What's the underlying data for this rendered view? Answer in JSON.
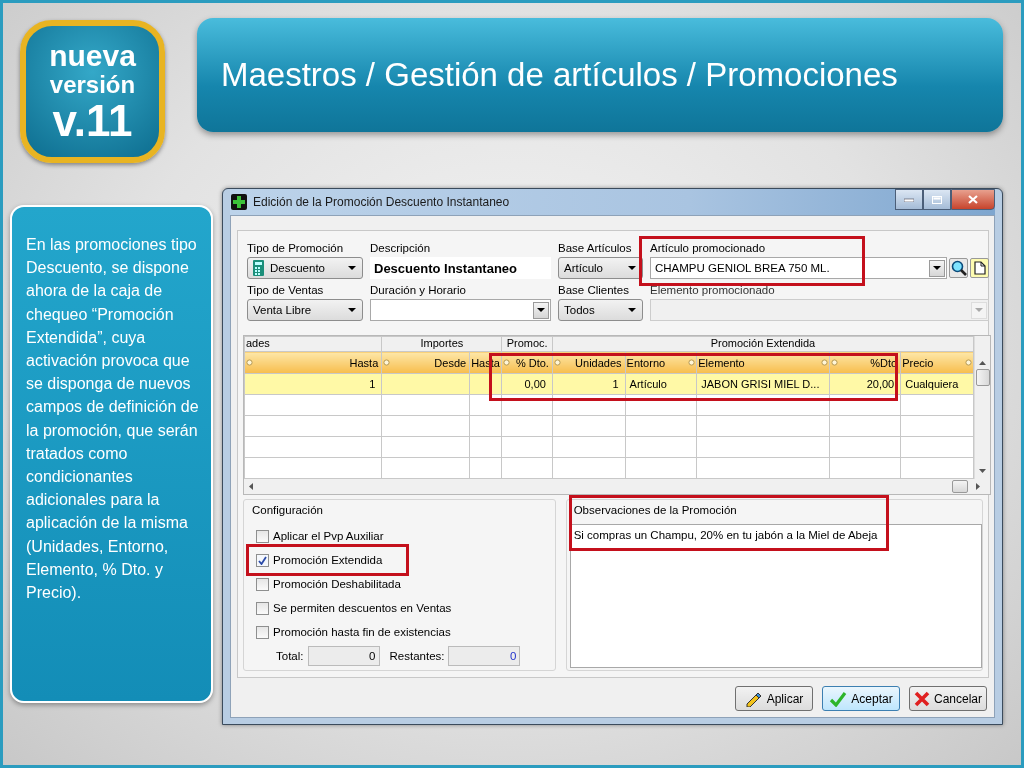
{
  "logo": {
    "lines": [
      "nueva",
      "versión",
      "v.11"
    ]
  },
  "title": "Maestros / Gestión de artículos / Promociones",
  "note": "En las promociones tipo Descuento, se dispone ahora de la caja de chequeo “Promoción Extendida”, cuya activación provoca que se disponga de nuevos campos de definición de la promoción, que serán tratados como condicionantes adicionales para la aplicación de la misma (Unidades, Entorno, Elemento, % Dto. y Precio).",
  "window": {
    "title": "Edición de la Promoción Descuento Instantaneo",
    "fields": [
      {
        "kind": "dropdown",
        "label": "Tipo de Promoción",
        "value": "Descuento",
        "icon": true
      },
      {
        "kind": "text",
        "label": "Descripción",
        "value": "Descuento Instantaneo"
      },
      {
        "kind": "dropdown",
        "label": "Base Artículos",
        "value": "Artículo"
      },
      {
        "kind": "lookup",
        "label": "Artículo promocionado",
        "value": "CHAMPU GENIOL BREA 750 ML.",
        "disabled": false
      },
      {
        "kind": "dropdown",
        "label": "Tipo de Ventas",
        "value": "Venta Libre"
      },
      {
        "kind": "combo",
        "label": "Duración y Horario",
        "disabled": false
      },
      {
        "kind": "dropdown",
        "label": "Base Clientes",
        "value": "Todos"
      },
      {
        "kind": "combo",
        "label": "Elemento promocionado",
        "disabled": true
      }
    ],
    "grid": {
      "groups": [
        {
          "label": "ades",
          "columns": [
            {
              "label": "Hasta",
              "sort_marker": true,
              "kind": "number"
            }
          ]
        },
        {
          "label": "Importes",
          "columns": [
            {
              "label": "Desde",
              "sort_marker": true,
              "kind": "number"
            },
            {
              "label": "Hasta",
              "sort_marker": false,
              "kind": "number"
            }
          ]
        },
        {
          "label": "Promoc.",
          "columns": [
            {
              "label": "% Dto.",
              "sort_marker": true,
              "kind": "number"
            }
          ]
        },
        {
          "label": "Promoción Extendida",
          "columns": [
            {
              "label": "Unidades",
              "sort_marker": true,
              "kind": "number"
            },
            {
              "label": "Entorno",
              "sort_marker": true,
              "kind": "text"
            },
            {
              "label": "Elemento",
              "sort_marker": true,
              "kind": "text"
            },
            {
              "label": "%Dto",
              "sort_marker": true,
              "kind": "number"
            },
            {
              "label": "Precio",
              "sort_marker": true,
              "kind": "text"
            }
          ]
        }
      ],
      "rows": [
        {
          "selected": true,
          "cells": [
            "1",
            "",
            "",
            "0,00",
            "1",
            "Artículo",
            "JABON GRISI MIEL D...",
            "20,00",
            "Cualquiera"
          ]
        }
      ]
    },
    "configuration": {
      "label": "Configuración",
      "checkboxes": [
        {
          "label": "Aplicar el Pvp Auxiliar",
          "checked": false
        },
        {
          "label": "Promoción Extendida",
          "checked": true
        },
        {
          "label": "Promoción Deshabilitada",
          "checked": false
        },
        {
          "label": "Se permiten descuentos en Ventas",
          "checked": false
        },
        {
          "label": "Promoción hasta fin de existencias",
          "checked": false
        }
      ],
      "total_label": "Total:",
      "total": "0",
      "remaining_label": "Restantes:",
      "remaining": "0"
    },
    "observations": {
      "label": "Observaciones de la Promoción",
      "text": "Si compras un Champu, 20% en tu jabón a la Miel de Abeja"
    },
    "buttons": [
      {
        "label": "Aplicar",
        "kind": "apply",
        "default": false
      },
      {
        "label": "Aceptar",
        "kind": "accept",
        "default": true
      },
      {
        "label": "Cancelar",
        "kind": "cancel",
        "default": false
      }
    ]
  }
}
